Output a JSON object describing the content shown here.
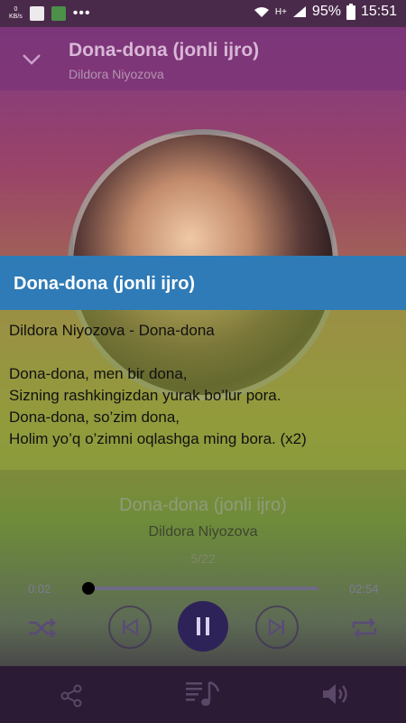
{
  "status": {
    "kb_label": "0\nKB/s",
    "battery": "95%",
    "time": "15:51",
    "net": "H+"
  },
  "header": {
    "title": "Dona-dona (jonli ijro)",
    "artist": "Dildora Niyozova"
  },
  "lyrics": {
    "title": "Dona-dona (jonli ijro)",
    "lines": [
      "Dildora Niyozova - Dona-dona",
      "",
      "Dona-dona, men bir dona,",
      "Sizning rashkingizdan yurak bo’lur pora.",
      "Dona-dona, so’zim dona,",
      "Holim yo’q o’zimni oqlashga ming bora. (x2)"
    ]
  },
  "player": {
    "title": "Dona-dona (jonli ijro)",
    "artist": "Dildora Niyozova",
    "track_count": "5/22",
    "elapsed": "0:02",
    "duration": "02:54",
    "progress_fraction": 0.012
  },
  "icons": {
    "back": "chevron-down-icon",
    "shuffle": "shuffle-icon",
    "prev": "skip-previous-icon",
    "pause": "pause-icon",
    "next": "skip-next-icon",
    "repeat": "repeat-icon",
    "share": "share-icon",
    "playlist": "playlist-music-icon",
    "volume": "volume-icon"
  },
  "colors": {
    "lyrics_header": "#2f7bb7",
    "play_button": "#2e2358"
  }
}
